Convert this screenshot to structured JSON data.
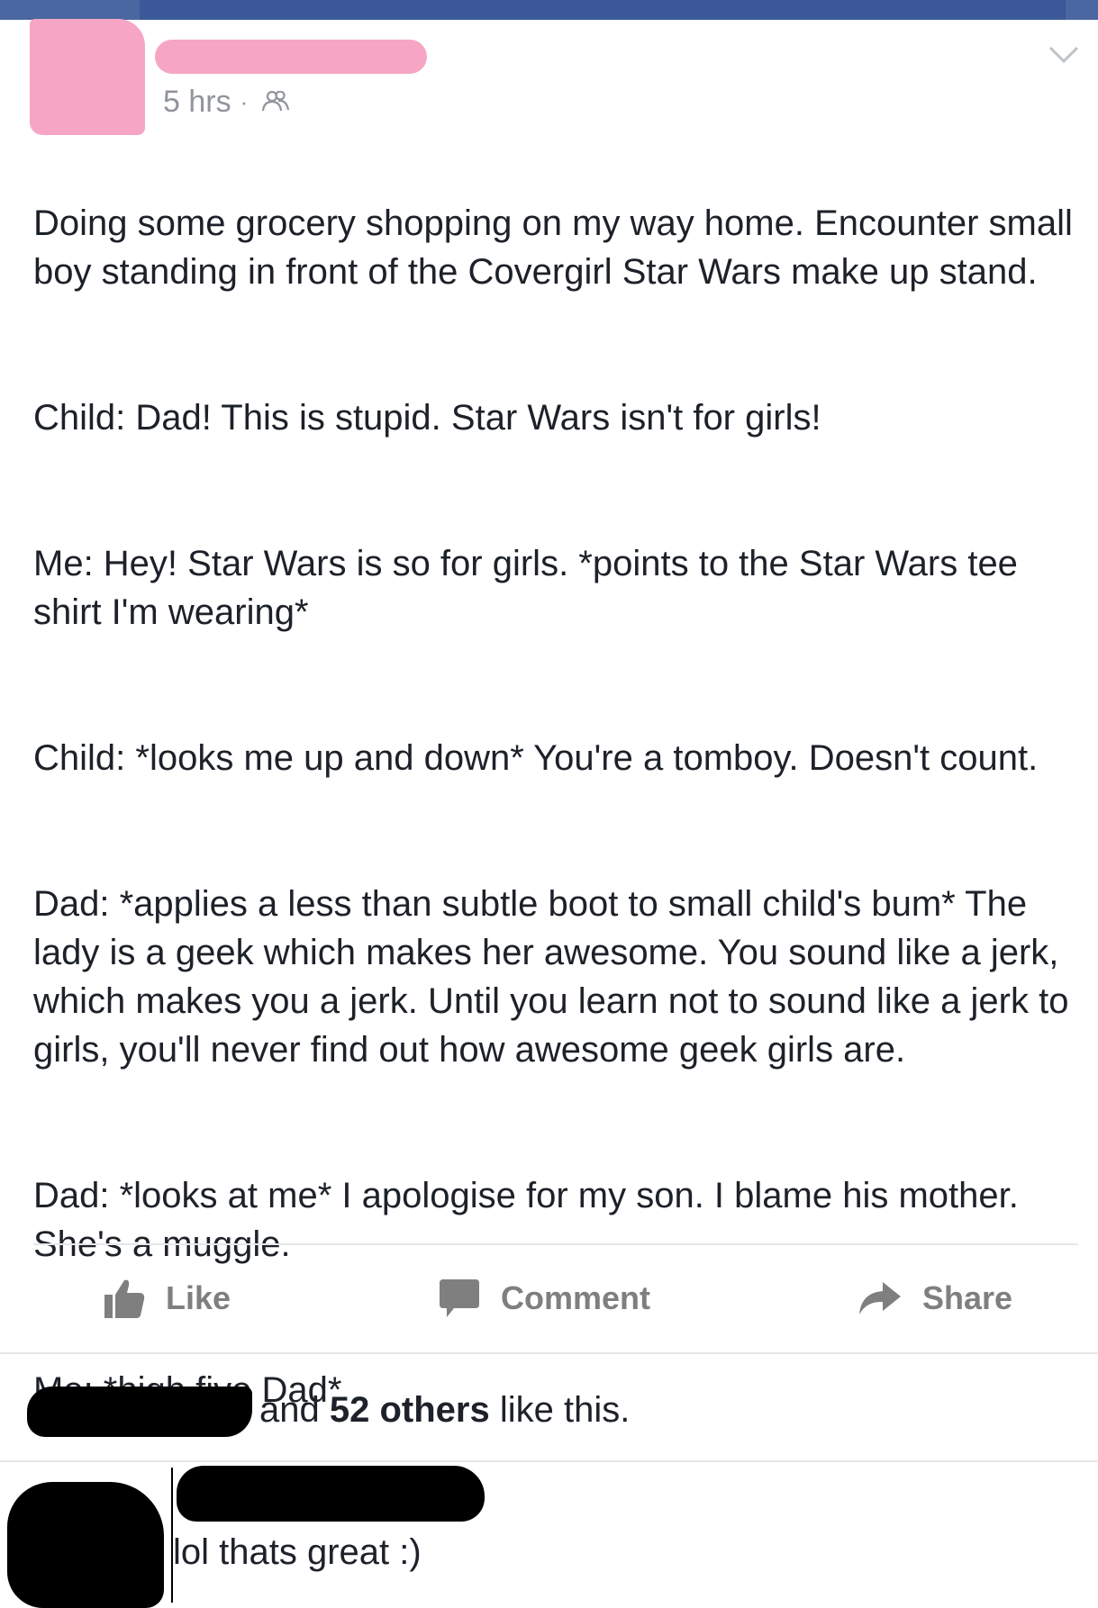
{
  "post": {
    "time": "5 hrs",
    "separator": "·",
    "audience_icon": "friends-icon",
    "menu_icon": "chevron-down-icon",
    "paragraphs": [
      "Doing some grocery shopping on my way home. Encounter small boy standing in front of the Covergirl Star Wars make up stand.",
      "Child: Dad! This is stupid. Star Wars isn't for girls!",
      "Me: Hey! Star Wars is so for girls. *points to the Star Wars tee shirt I'm wearing*",
      "Child: *looks me up and down* You're a tomboy. Doesn't count.",
      "Dad: *applies a less than subtle boot to small child's bum* The lady is a geek which makes her awesome.  You sound like a jerk, which makes you a jerk. Until you learn not to sound like a jerk to girls, you'll never find out how awesome geek girls are.",
      "Dad: *looks at me* I apologise for my son. I blame his mother. She's a muggle.",
      "Me: *high five Dad*"
    ]
  },
  "actions": {
    "like_label": "Like",
    "comment_label": "Comment",
    "share_label": "Share"
  },
  "likes": {
    "prefix": "and ",
    "count_text": "52 others",
    "suffix": " like this."
  },
  "comment": {
    "text": "lol thats great :)"
  },
  "colors": {
    "topbar": "#3b5998",
    "redaction_pink": "#f6a6c4",
    "redaction_black": "#000000",
    "action_gray": "#7f7f7f",
    "meta_gray": "#90949c"
  }
}
